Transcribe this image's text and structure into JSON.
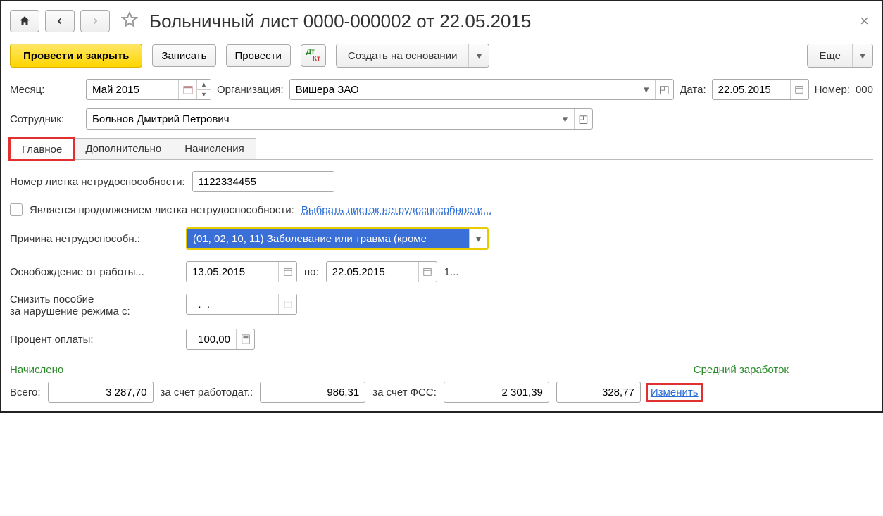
{
  "header": {
    "title": "Больничный лист 0000-000002 от 22.05.2015"
  },
  "toolbar": {
    "post_close": "Провести и закрыть",
    "save": "Записать",
    "post": "Провести",
    "create_based": "Создать на основании",
    "more": "Еще"
  },
  "fields": {
    "month_label": "Месяц:",
    "month_value": "Май 2015",
    "org_label": "Организация:",
    "org_value": "Вишера ЗАО",
    "date_label": "Дата:",
    "date_value": "22.05.2015",
    "number_label": "Номер:",
    "number_value": "000",
    "employee_label": "Сотрудник:",
    "employee_value": "Больнов Дмитрий Петрович"
  },
  "tabs": {
    "main": "Главное",
    "additional": "Дополнительно",
    "accruals": "Начисления"
  },
  "main": {
    "sheet_number_label": "Номер листка нетрудоспособности:",
    "sheet_number_value": "1122334455",
    "is_continuation_label": "Является продолжением листка нетрудоспособности:",
    "select_sheet_link": "Выбрать листок нетрудоспособности...",
    "reason_label": "Причина нетрудоспособн.:",
    "reason_value": "(01, 02, 10, 11) Заболевание или травма (кроме",
    "release_label": "Освобождение от работы...",
    "release_from": "13.05.2015",
    "release_to_label": "по:",
    "release_to": "22.05.2015",
    "release_suffix": "1...",
    "reduce_label_l1": "Снизить пособие",
    "reduce_label_l2": "за нарушение режима с:",
    "reduce_value": "  .  .",
    "percent_label": "Процент оплаты:",
    "percent_value": "100,00"
  },
  "results": {
    "accrued_h": "Начислено",
    "avg_h": "Средний заработок",
    "total_label": "Всего:",
    "total_value": "3 287,70",
    "employer_label": "за счет работодат.:",
    "employer_value": "986,31",
    "fss_label": "за счет ФСС:",
    "fss_value": "2 301,39",
    "avg_value": "328,77",
    "change_link": "Изменить"
  }
}
